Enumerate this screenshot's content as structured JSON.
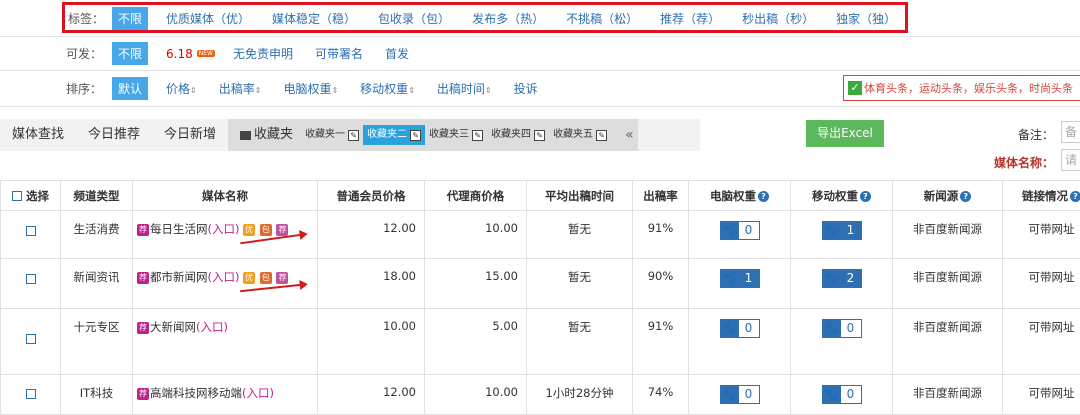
{
  "filters": {
    "tags": {
      "label": "标签：",
      "options": [
        "不限",
        "优质媒体（优）",
        "媒体稳定（稳）",
        "包收录（包）",
        "发布多（热）",
        "不挑稿（松）",
        "推荐（荐）",
        "秒出稿（秒）",
        "独家（独）"
      ]
    },
    "publish": {
      "label": "可发：",
      "all": "不限",
      "hot": "6.18",
      "new": "NEW",
      "options": [
        "无免责申明",
        "可带署名",
        "首发"
      ]
    },
    "sort": {
      "label": "排序：",
      "default": "默认",
      "options": [
        "价格",
        "出稿率",
        "电脑权重",
        "移动权重",
        "出稿时间"
      ],
      "complaint": "投诉",
      "arrow": "⇕"
    }
  },
  "notice": "体育头条，运动头条，娱乐头条，时尚头条",
  "tabs": [
    "媒体查找",
    "今日推荐",
    "今日新增"
  ],
  "favorites": {
    "label": "收藏夹",
    "subs": [
      "收藏夹一",
      "收藏夹二",
      "收藏夹三",
      "收藏夹四",
      "收藏夹五"
    ],
    "more": "«"
  },
  "export_label": "导出Excel",
  "remark_label": "备注：",
  "remark_placeholder": "备",
  "media_name_label": "媒体名称：",
  "media_name_placeholder": "请",
  "table": {
    "headers": [
      "选择",
      "频道类型",
      "媒体名称",
      "普通会员价格",
      "代理商价格",
      "平均出稿时间",
      "出稿率",
      "电脑权重",
      "移动权重",
      "新闻源",
      "链接情况"
    ],
    "entry": "(入口)",
    "rows": [
      {
        "type": "生活消费",
        "name": "每日生活网",
        "price": "12.00",
        "agent": "10.00",
        "time": "暂无",
        "rate": "91%",
        "pc": "0",
        "mobile": "1",
        "news": "非百度新闻源",
        "link": "可带网址",
        "tags": [
          "优",
          "包",
          "荐"
        ]
      },
      {
        "type": "新闻资讯",
        "name": "都市新闻网",
        "price": "18.00",
        "agent": "15.00",
        "time": "暂无",
        "rate": "90%",
        "pc": "1",
        "mobile": "2",
        "news": "非百度新闻源",
        "link": "可带网址",
        "tags": [
          "优",
          "包",
          "荐"
        ]
      },
      {
        "type": "十元专区",
        "name": "大新闻网",
        "price": "10.00",
        "agent": "5.00",
        "time": "暂无",
        "rate": "91%",
        "pc": "0",
        "mobile": "0",
        "news": "非百度新闻源",
        "link": "可带网址",
        "tags": []
      },
      {
        "type": "IT科技",
        "name": "高端科技网移动端",
        "price": "12.00",
        "agent": "10.00",
        "time": "1小时28分钟",
        "rate": "74%",
        "pc": "0",
        "mobile": "0",
        "news": "非百度新闻源",
        "link": "可带网址",
        "tags": []
      }
    ]
  }
}
